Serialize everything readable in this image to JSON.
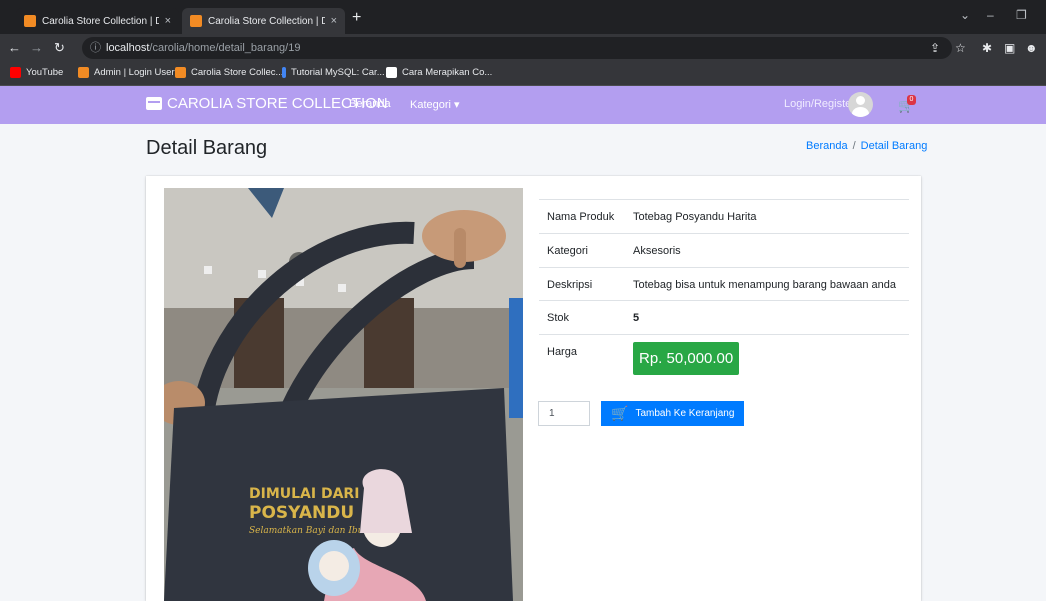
{
  "browser": {
    "tabs": [
      {
        "title": "Carolia Store Collection | Dashbo",
        "close": "×"
      },
      {
        "title": "Carolia Store Collection | Detail B",
        "close": "×"
      }
    ],
    "new_tab": "+",
    "url_host": "localhost",
    "url_path": "/carolia/home/detail_barang/19",
    "bookmarks": [
      {
        "label": "YouTube",
        "color": "#ff0000"
      },
      {
        "label": "Admin | Login User",
        "color": "#f28b24"
      },
      {
        "label": "Carolia Store Collec...",
        "color": "#f28b24"
      },
      {
        "label": "Tutorial MySQL: Car...",
        "color": "#4285f4"
      },
      {
        "label": "Cara Merapikan Co...",
        "color": "#ffffff"
      }
    ]
  },
  "navbar": {
    "brand": "CAROLIA STORE COLLECTION",
    "links": [
      "Beranda",
      "Kategori ▾"
    ],
    "login": "Login/Register",
    "cart_count": "0",
    "bg_color": "#b39ef0"
  },
  "header": {
    "title": "Detail Barang",
    "breadcrumb": [
      "Beranda",
      "/",
      "Detail Barang"
    ]
  },
  "product": {
    "image_text": {
      "line1": "DIMULAI DARI",
      "line2": "POSYANDU",
      "line3": "Selamatkan Bayi dan Ibu"
    },
    "fields": [
      {
        "label": "Nama Produk",
        "value": "Totebag Posyandu Harita"
      },
      {
        "label": "Kategori",
        "value": "Aksesoris"
      },
      {
        "label": "Deskripsi",
        "value": "Totebag bisa untuk menampung barang bawaan anda"
      },
      {
        "label": "Stok",
        "value": "5"
      },
      {
        "label": "Harga",
        "value": "Rp. 50,000.00"
      }
    ],
    "price_color": "#28a745",
    "quantity": "1",
    "add_to_cart": "Tambah Ke Keranjang"
  }
}
